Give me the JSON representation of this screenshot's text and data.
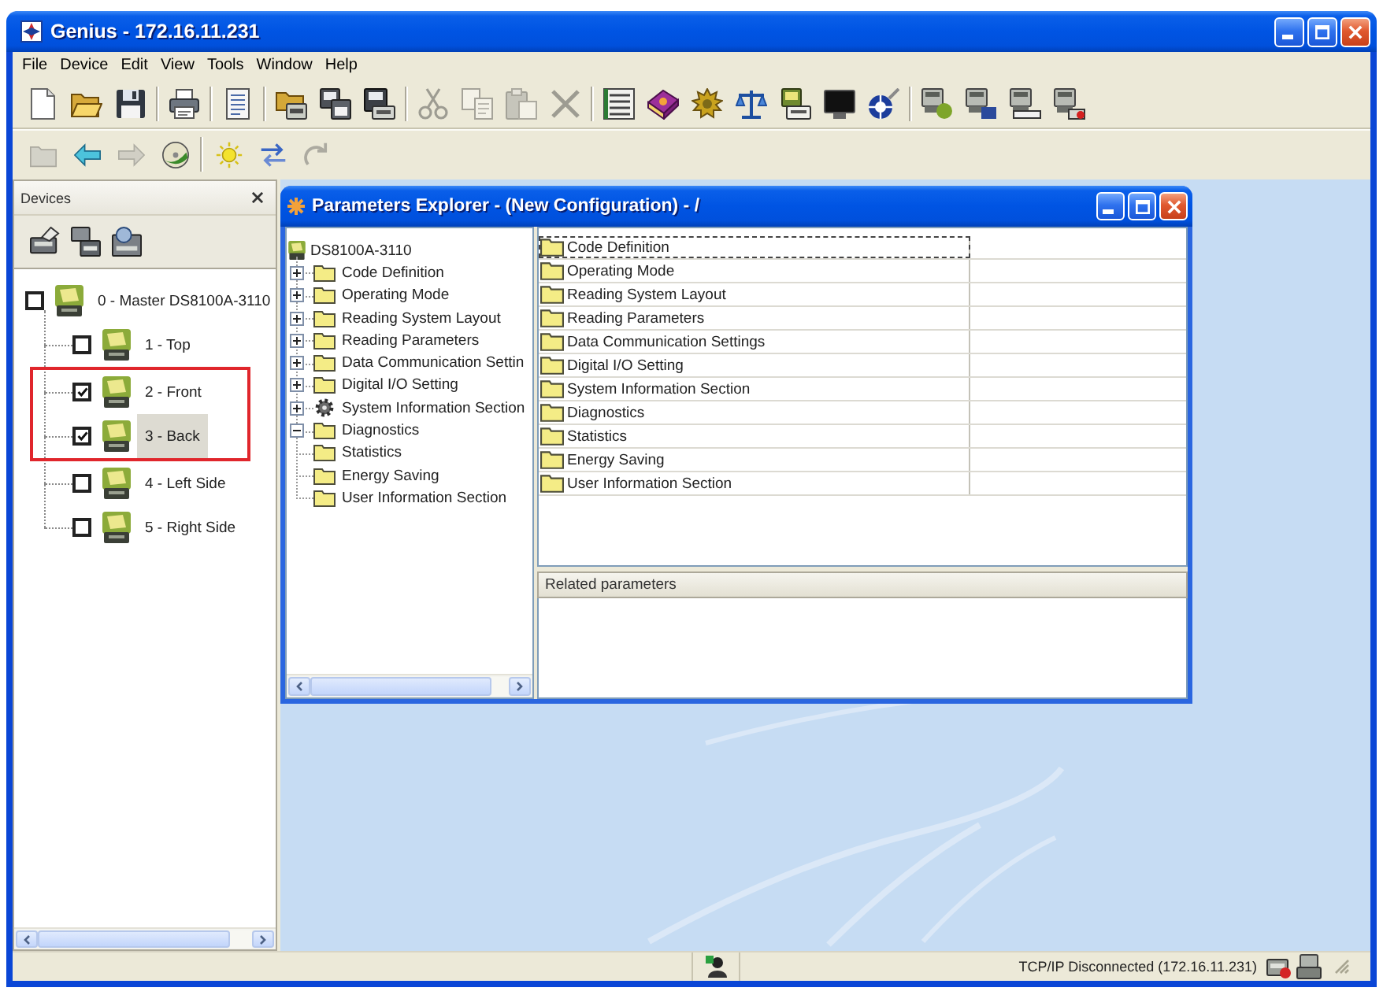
{
  "window": {
    "title": "Genius - 172.16.11.231"
  },
  "menu": [
    "File",
    "Device",
    "Edit",
    "View",
    "Tools",
    "Window",
    "Help"
  ],
  "toolbars": [
    {
      "buttons": [
        {
          "kind": "new",
          "disabled": false
        },
        {
          "kind": "open",
          "disabled": false
        },
        {
          "kind": "save",
          "disabled": false
        },
        {
          "kind": "separator"
        },
        {
          "kind": "print",
          "disabled": false
        },
        {
          "kind": "separator"
        },
        {
          "kind": "sheet",
          "disabled": false
        },
        {
          "kind": "separator"
        },
        {
          "kind": "deviceopen",
          "disabled": false
        },
        {
          "kind": "devicecopy",
          "disabled": false
        },
        {
          "kind": "devicesave",
          "disabled": false
        },
        {
          "kind": "separator"
        },
        {
          "kind": "cut",
          "disabled": true
        },
        {
          "kind": "copy",
          "disabled": true
        },
        {
          "kind": "paste",
          "disabled": true
        },
        {
          "kind": "delete",
          "disabled": true
        },
        {
          "kind": "separator"
        },
        {
          "kind": "columns",
          "disabled": false
        },
        {
          "kind": "book",
          "disabled": false
        },
        {
          "kind": "gear",
          "disabled": false
        },
        {
          "kind": "scale",
          "disabled": false
        },
        {
          "kind": "deviceprint",
          "disabled": false
        },
        {
          "kind": "monitor",
          "disabled": false
        },
        {
          "kind": "target",
          "disabled": false
        },
        {
          "kind": "separator"
        },
        {
          "kind": "netread",
          "disabled": false
        },
        {
          "kind": "netwrite",
          "disabled": false
        },
        {
          "kind": "netlink",
          "disabled": false
        },
        {
          "kind": "netstop",
          "disabled": false
        }
      ]
    },
    {
      "buttons": [
        {
          "kind": "folder",
          "disabled": true
        },
        {
          "kind": "back",
          "disabled": false
        },
        {
          "kind": "forward",
          "disabled": true
        },
        {
          "kind": "disc",
          "disabled": false
        },
        {
          "kind": "separator"
        },
        {
          "kind": "sun",
          "disabled": false
        },
        {
          "kind": "swap",
          "disabled": false
        },
        {
          "kind": "redo",
          "disabled": true
        }
      ]
    }
  ],
  "devices_panel": {
    "title": "Devices",
    "tree": {
      "label": "0 - Master DS8100A-3110",
      "checked": false,
      "selected": false,
      "children": [
        {
          "label": "1 - Top",
          "checked": false,
          "selected": false,
          "highlighted": false
        },
        {
          "label": "2 - Front",
          "checked": true,
          "selected": false,
          "highlighted": true
        },
        {
          "label": "3 - Back",
          "checked": true,
          "selected": true,
          "highlighted": true
        },
        {
          "label": "4 - Left Side",
          "checked": false,
          "selected": false,
          "highlighted": false
        },
        {
          "label": "5 - Right Side",
          "checked": false,
          "selected": false,
          "highlighted": false
        }
      ]
    }
  },
  "parameters_explorer": {
    "title": "Parameters Explorer - (New Configuration) - /",
    "tree": {
      "label": "DS8100A-3110",
      "children": [
        {
          "label": "Code Definition",
          "kind": "folder",
          "has_children": true,
          "expanded": false
        },
        {
          "label": "Operating Mode",
          "kind": "folder",
          "has_children": true,
          "expanded": false
        },
        {
          "label": "Reading System Layout",
          "kind": "folder",
          "has_children": true,
          "expanded": false
        },
        {
          "label": "Reading Parameters",
          "kind": "folder",
          "has_children": true,
          "expanded": false
        },
        {
          "label": "Data Communication Settin",
          "kind": "folder",
          "has_children": true,
          "expanded": false
        },
        {
          "label": "Digital I/O Setting",
          "kind": "folder",
          "has_children": true,
          "expanded": false
        },
        {
          "label": "System Information Section",
          "kind": "module",
          "has_children": true,
          "expanded": false
        },
        {
          "label": "Diagnostics",
          "kind": "folder",
          "has_children": true,
          "expanded": true
        },
        {
          "label": "Statistics",
          "kind": "folder",
          "has_children": false
        },
        {
          "label": "Energy Saving",
          "kind": "folder",
          "has_children": false
        },
        {
          "label": "User Information Section",
          "kind": "folder",
          "has_children": false
        }
      ]
    },
    "list": [
      {
        "label": "Code Definition",
        "focused": true
      },
      {
        "label": "Operating Mode",
        "focused": false
      },
      {
        "label": "Reading System Layout",
        "focused": false
      },
      {
        "label": "Reading Parameters",
        "focused": false
      },
      {
        "label": "Data Communication Settings",
        "focused": false
      },
      {
        "label": "Digital I/O Setting",
        "focused": false
      },
      {
        "label": "System Information Section",
        "focused": false
      },
      {
        "label": "Diagnostics",
        "focused": false
      },
      {
        "label": "Statistics",
        "focused": false
      },
      {
        "label": "Energy Saving",
        "focused": false
      },
      {
        "label": "User Information Section",
        "focused": false
      }
    ],
    "related_header": "Related parameters"
  },
  "status_bar": {
    "connection": "TCP/IP Disconnected (172.16.11.231)"
  }
}
